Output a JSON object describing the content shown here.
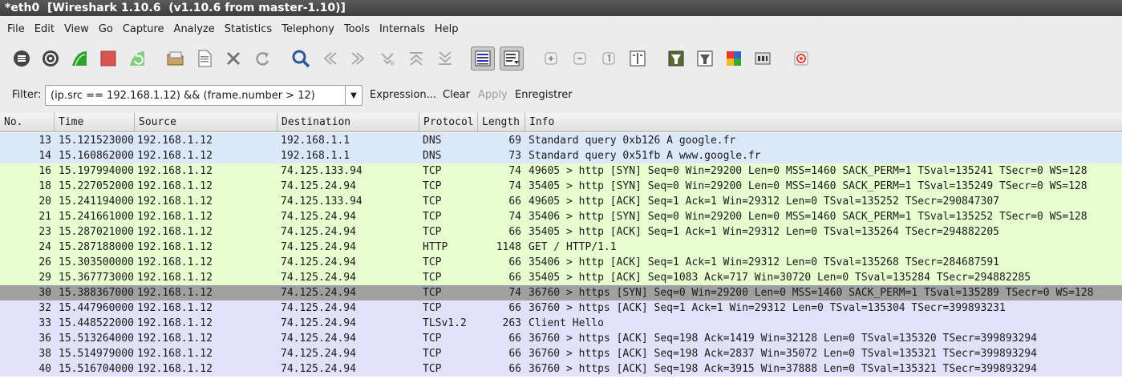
{
  "window": {
    "title": "*eth0  [Wireshark 1.10.6  (v1.10.6 from master-1.10)]"
  },
  "menu": [
    "File",
    "Edit",
    "View",
    "Go",
    "Capture",
    "Analyze",
    "Statistics",
    "Telephony",
    "Tools",
    "Internals",
    "Help"
  ],
  "toolbar_icons": [
    "interface-list-icon",
    "capture-options-icon",
    "start-capture-icon",
    "stop-capture-icon",
    "restart-capture-icon",
    "open-file-icon",
    "save-file-icon",
    "close-file-icon",
    "reload-icon",
    "find-packet-icon",
    "go-back-icon",
    "go-forward-icon",
    "go-to-packet-icon",
    "go-first-icon",
    "go-last-icon",
    "colorize-icon",
    "autoscroll-icon",
    "zoom-in-icon",
    "zoom-out-icon",
    "normal-size-icon",
    "resize-columns-icon",
    "capture-filters-icon",
    "display-filters-icon",
    "coloring-rules-icon",
    "preferences-icon",
    "help-icon"
  ],
  "filter": {
    "label": "Filter:",
    "value": "(ip.src == 192.168.1.12) && (frame.number > 12)",
    "expression": "Expression...",
    "clear": "Clear",
    "apply": "Apply",
    "save": "Enregistrer"
  },
  "columns": [
    "No.",
    "Time",
    "Source",
    "Destination",
    "Protocol",
    "Length",
    "Info"
  ],
  "colors": {
    "dns": "#dae8fa",
    "tcp": "#e8fdcf",
    "tls": "#e3e1f9",
    "selected": "#a0a0a0"
  },
  "packets": [
    {
      "no": "13",
      "time": "15.121523000",
      "src": "192.168.1.12",
      "dst": "192.168.1.1",
      "proto": "DNS",
      "len": "69",
      "info": "Standard query 0xb126  A google.fr",
      "color": "dns"
    },
    {
      "no": "14",
      "time": "15.160862000",
      "src": "192.168.1.12",
      "dst": "192.168.1.1",
      "proto": "DNS",
      "len": "73",
      "info": "Standard query 0x51fb  A www.google.fr",
      "color": "dns"
    },
    {
      "no": "16",
      "time": "15.197994000",
      "src": "192.168.1.12",
      "dst": "74.125.133.94",
      "proto": "TCP",
      "len": "74",
      "info": "49605 > http [SYN] Seq=0 Win=29200 Len=0 MSS=1460 SACK_PERM=1 TSval=135241 TSecr=0 WS=128",
      "color": "tcp"
    },
    {
      "no": "18",
      "time": "15.227052000",
      "src": "192.168.1.12",
      "dst": "74.125.24.94",
      "proto": "TCP",
      "len": "74",
      "info": "35405 > http [SYN] Seq=0 Win=29200 Len=0 MSS=1460 SACK_PERM=1 TSval=135249 TSecr=0 WS=128",
      "color": "tcp"
    },
    {
      "no": "20",
      "time": "15.241194000",
      "src": "192.168.1.12",
      "dst": "74.125.133.94",
      "proto": "TCP",
      "len": "66",
      "info": "49605 > http [ACK] Seq=1 Ack=1 Win=29312 Len=0 TSval=135252 TSecr=290847307",
      "color": "tcp"
    },
    {
      "no": "21",
      "time": "15.241661000",
      "src": "192.168.1.12",
      "dst": "74.125.24.94",
      "proto": "TCP",
      "len": "74",
      "info": "35406 > http [SYN] Seq=0 Win=29200 Len=0 MSS=1460 SACK_PERM=1 TSval=135252 TSecr=0 WS=128",
      "color": "tcp"
    },
    {
      "no": "23",
      "time": "15.287021000",
      "src": "192.168.1.12",
      "dst": "74.125.24.94",
      "proto": "TCP",
      "len": "66",
      "info": "35405 > http [ACK] Seq=1 Ack=1 Win=29312 Len=0 TSval=135264 TSecr=294882205",
      "color": "tcp"
    },
    {
      "no": "24",
      "time": "15.287188000",
      "src": "192.168.1.12",
      "dst": "74.125.24.94",
      "proto": "HTTP",
      "len": "1148",
      "info": "GET / HTTP/1.1",
      "color": "tcp"
    },
    {
      "no": "26",
      "time": "15.303500000",
      "src": "192.168.1.12",
      "dst": "74.125.24.94",
      "proto": "TCP",
      "len": "66",
      "info": "35406 > http [ACK] Seq=1 Ack=1 Win=29312 Len=0 TSval=135268 TSecr=284687591",
      "color": "tcp"
    },
    {
      "no": "29",
      "time": "15.367773000",
      "src": "192.168.1.12",
      "dst": "74.125.24.94",
      "proto": "TCP",
      "len": "66",
      "info": "35405 > http [ACK] Seq=1083 Ack=717 Win=30720 Len=0 TSval=135284 TSecr=294882285",
      "color": "tcp"
    },
    {
      "no": "30",
      "time": "15.388367000",
      "src": "192.168.1.12",
      "dst": "74.125.24.94",
      "proto": "TCP",
      "len": "74",
      "info": "36760 > https [SYN] Seq=0 Win=29200 Len=0 MSS=1460 SACK_PERM=1 TSval=135289 TSecr=0 WS=128",
      "color": "selected"
    },
    {
      "no": "32",
      "time": "15.447960000",
      "src": "192.168.1.12",
      "dst": "74.125.24.94",
      "proto": "TCP",
      "len": "66",
      "info": "36760 > https [ACK] Seq=1 Ack=1 Win=29312 Len=0 TSval=135304 TSecr=399893231",
      "color": "tls"
    },
    {
      "no": "33",
      "time": "15.448522000",
      "src": "192.168.1.12",
      "dst": "74.125.24.94",
      "proto": "TLSv1.2",
      "len": "263",
      "info": "Client Hello",
      "color": "tls"
    },
    {
      "no": "36",
      "time": "15.513264000",
      "src": "192.168.1.12",
      "dst": "74.125.24.94",
      "proto": "TCP",
      "len": "66",
      "info": "36760 > https [ACK] Seq=198 Ack=1419 Win=32128 Len=0 TSval=135320 TSecr=399893294",
      "color": "tls"
    },
    {
      "no": "38",
      "time": "15.514979000",
      "src": "192.168.1.12",
      "dst": "74.125.24.94",
      "proto": "TCP",
      "len": "66",
      "info": "36760 > https [ACK] Seq=198 Ack=2837 Win=35072 Len=0 TSval=135321 TSecr=399893294",
      "color": "tls"
    },
    {
      "no": "40",
      "time": "15.516704000",
      "src": "192.168.1.12",
      "dst": "74.125.24.94",
      "proto": "TCP",
      "len": "66",
      "info": "36760 > https [ACK] Seq=198 Ack=3915 Win=37888 Len=0 TSval=135321 TSecr=399893294",
      "color": "tls"
    }
  ]
}
